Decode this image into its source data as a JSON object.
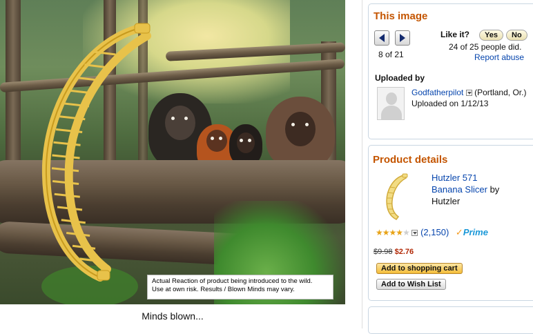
{
  "photo": {
    "overlay_caption_line1": "Actual Reaction of product being introduced to the wild.",
    "overlay_caption_line2": "Use at own risk. Results / Blown Minds may vary.",
    "caption": "Minds blown..."
  },
  "this_image": {
    "title": "This image",
    "position": "8 of 21",
    "like_prompt": "Like it?",
    "yes_label": "Yes",
    "no_label": "No",
    "votes_text": "24 of 25 people did.",
    "report_label": "Report abuse",
    "uploaded_by_label": "Uploaded by",
    "uploader_name": "Godfatherpilot",
    "uploader_location": "(Portland, Or.)",
    "uploaded_on": "Uploaded on 1/12/13"
  },
  "product": {
    "title": "Product details",
    "name_line1": "Hutzler 571",
    "name_line2": "Banana Slicer",
    "by_text": " by",
    "brand": "Hutzler",
    "rating_stars": 3.5,
    "review_count": "(2,150)",
    "prime_check": "✓",
    "prime_label": "Prime",
    "list_price": "$9.98",
    "sale_price": "$2.76",
    "add_to_cart_label": "Add to shopping cart",
    "add_to_wishlist_label": "Add to Wish List"
  },
  "colors": {
    "section_title": "#c45500",
    "link": "#0645ad",
    "sale_price": "#b12704",
    "slicer_yellow": "#e8c24a"
  }
}
